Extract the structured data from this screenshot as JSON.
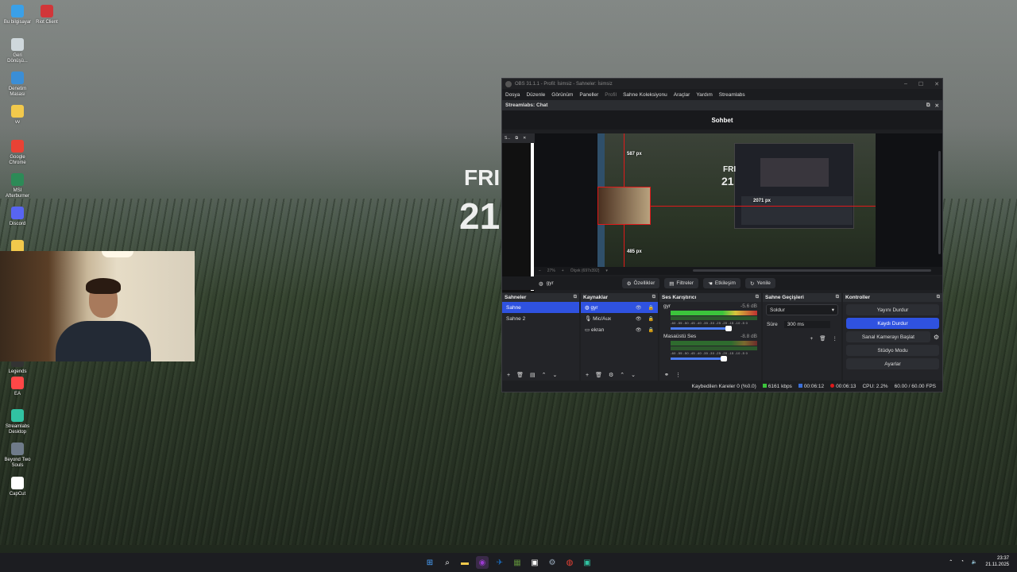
{
  "desktop": {
    "icons": [
      {
        "label": "Bu bilgisayar",
        "icon": "monitor-icon",
        "color": "#3aa0e8"
      },
      {
        "label": "Riot Client",
        "icon": "riot-icon",
        "color": "#d13639"
      },
      {
        "label": "Geri Dönüşü...",
        "icon": "recycle-bin-icon",
        "color": "#cfd8dc"
      },
      {
        "label": "Denetim Masası",
        "icon": "control-panel-icon",
        "color": "#3b8ed6"
      },
      {
        "label": "vv",
        "icon": "folder-icon",
        "color": "#f2c94c"
      },
      {
        "label": "Google Chrome",
        "icon": "chrome-icon",
        "color": "#e94235"
      },
      {
        "label": "MSI Afterburner",
        "icon": "afterburner-icon",
        "color": "#2d8a57"
      },
      {
        "label": "Discord",
        "icon": "discord-icon",
        "color": "#5865f2"
      },
      {
        "label": "",
        "icon": "folder-icon",
        "color": "#f2c94c"
      },
      {
        "label": "Legends",
        "icon": "legends-icon",
        "color": "#333333"
      },
      {
        "label": "EA",
        "icon": "ea-icon",
        "color": "#ff4747"
      },
      {
        "label": "Streamlabs Desktop",
        "icon": "streamlabs-icon",
        "color": "#31c3a2"
      },
      {
        "label": "Beyond Two Souls",
        "icon": "game-icon",
        "color": "#6f7b8a"
      },
      {
        "label": "CapCut",
        "icon": "capcut-icon",
        "color": "#ffffff"
      }
    ],
    "clock_day": "FRI",
    "clock_date": "21"
  },
  "obs": {
    "title": "OBS 31.1.1 - Profil: İsimsiz - Sahneler: İsimsiz",
    "menu": [
      "Dosya",
      "Düzenle",
      "Görünüm",
      "Paneller",
      "Profil",
      "Sahne Koleksiyonu",
      "Araçlar",
      "Yardım",
      "Streamlabs"
    ],
    "chat_dock_title": "Streamlabs: Chat",
    "chat_header": "Sohbet",
    "side_panel_title": "S...",
    "preview": {
      "label_top": "587 px",
      "label_bottom": "485 px",
      "label_right": "2071 px",
      "zoom": "27%",
      "scale_text": "Ölçek (697x392)",
      "inner_day": "FRI",
      "inner_date": "21"
    },
    "source_bar": {
      "source_name": "gyr",
      "buttons": [
        "Özellikler",
        "Filtreler",
        "Etkileşim",
        "Yenile"
      ]
    },
    "scenes": {
      "title": "Sahneler",
      "items": [
        "Sahne",
        "Sahne 2"
      ],
      "selected": "Sahne"
    },
    "sources": {
      "title": "Kaynaklar",
      "items": [
        {
          "name": "gyr",
          "icon": "browser-source-icon"
        },
        {
          "name": "Mic/Aux",
          "icon": "microphone-icon"
        },
        {
          "name": "ekran",
          "icon": "display-capture-icon"
        }
      ]
    },
    "mixer": {
      "title": "Ses Karıştırıcı",
      "channels": [
        {
          "name": "gyr",
          "db": "-5.6 dB",
          "volume": 0.8
        },
        {
          "name": "Masaüstü Ses",
          "db": "-8.8 dB",
          "volume": 0.7
        }
      ],
      "ticks": "-60 -55 -50 -45 -40 -35 -30 -25 -20 -15 -10 -5 0"
    },
    "transitions": {
      "title": "Sahne Geçişleri",
      "type": "Soldur",
      "duration_label": "Süre",
      "duration_value": "300 ms"
    },
    "controls": {
      "title": "Kontroller",
      "buttons": [
        "Yayını Durdur",
        "Kaydı Durdur",
        "Sanal Kamerayı Başlat",
        "Stüdyo Modu",
        "Ayarlar"
      ],
      "active": "Kaydı Durdur"
    },
    "status": {
      "dropped": "Kaybedilen Kareler 0 (%0.0)",
      "bitrate": "6161 kbps",
      "stream_time": "00:06:12",
      "rec_time": "00:06:13",
      "cpu": "CPU: 2.2%",
      "fps": "60.00 / 60.00 FPS"
    }
  },
  "taskbar": {
    "icons": [
      "windows-start-icon",
      "search-icon",
      "file-explorer-icon",
      "obs-icon",
      "steam-icon",
      "minecraft-icon",
      "streamlabs-icon",
      "settings-icon",
      "chrome-icon",
      "streamlabs-desktop-icon"
    ],
    "time": "23:37",
    "date": "21.11.2025"
  }
}
